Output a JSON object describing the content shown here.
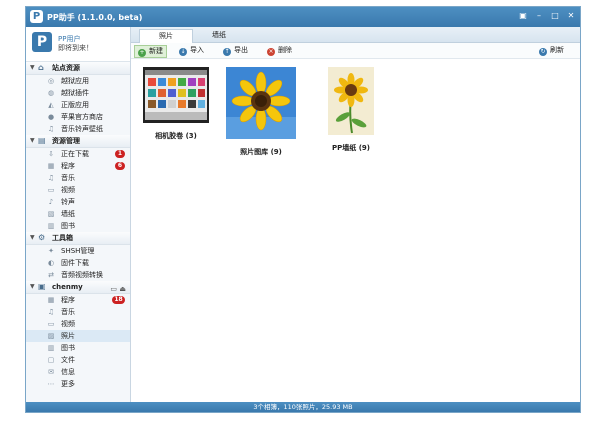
{
  "window": {
    "title": "PP助手 (1.1.0.0, beta)",
    "logo_letter": "P",
    "controls": [
      "▣",
      "–",
      "□",
      "✕"
    ]
  },
  "user": {
    "name": "PP用户",
    "welcome": "即将到来！"
  },
  "sidebar": {
    "groups": [
      {
        "label": "站点资源",
        "icon": "home-icon",
        "items": [
          {
            "label": "越狱应用",
            "icon": "app-icon"
          },
          {
            "label": "越狱插件",
            "icon": "plugin-icon"
          },
          {
            "label": "正版应用",
            "icon": "store-icon"
          },
          {
            "label": "苹果官方商店",
            "icon": "apple-icon"
          },
          {
            "label": "音乐铃声壁纸",
            "icon": "music-icon"
          }
        ]
      },
      {
        "label": "资源管理",
        "icon": "folder-icon",
        "items": [
          {
            "label": "正在下载",
            "icon": "download-icon",
            "badge": "1"
          },
          {
            "label": "程序",
            "icon": "program-icon",
            "badge": "6"
          },
          {
            "label": "音乐",
            "icon": "music-icon"
          },
          {
            "label": "视频",
            "icon": "video-icon"
          },
          {
            "label": "铃声",
            "icon": "ringtone-icon"
          },
          {
            "label": "墙纸",
            "icon": "wallpaper-icon"
          },
          {
            "label": "图书",
            "icon": "book-icon"
          }
        ]
      },
      {
        "label": "工具箱",
        "icon": "toolbox-icon",
        "items": [
          {
            "label": "SHSH管理",
            "icon": "shsh-icon"
          },
          {
            "label": "固件下载",
            "icon": "firmware-icon"
          },
          {
            "label": "音频视频转换",
            "icon": "convert-icon"
          }
        ]
      },
      {
        "label": "chenmy",
        "icon": "device-icon",
        "items": [
          {
            "label": "程序",
            "icon": "program-icon",
            "badge": "18"
          },
          {
            "label": "音乐",
            "icon": "music-icon"
          },
          {
            "label": "视频",
            "icon": "video-icon"
          },
          {
            "label": "照片",
            "icon": "photo-icon",
            "selected": true
          },
          {
            "label": "图书",
            "icon": "book-icon"
          },
          {
            "label": "文件",
            "icon": "file-icon"
          },
          {
            "label": "信息",
            "icon": "message-icon"
          },
          {
            "label": "更多",
            "icon": "more-icon"
          }
        ]
      }
    ]
  },
  "tabs": [
    {
      "label": "照片",
      "active": true
    },
    {
      "label": "墙纸",
      "active": false
    }
  ],
  "toolbar": {
    "new_label": "新建",
    "import_label": "导入",
    "export_label": "导出",
    "delete_label": "删除",
    "refresh_label": "刷新"
  },
  "albums": [
    {
      "label": "相机胶卷 (3)"
    },
    {
      "label": "照片图库 (9)"
    },
    {
      "label": "PP墙纸 (9)"
    }
  ],
  "status": {
    "text": "3个相簿，110张照片，25.93 MB"
  },
  "colors": {
    "titlebar": "#3a79ad",
    "badge": "#cc2222",
    "selected_row": "#dbe9f5"
  }
}
